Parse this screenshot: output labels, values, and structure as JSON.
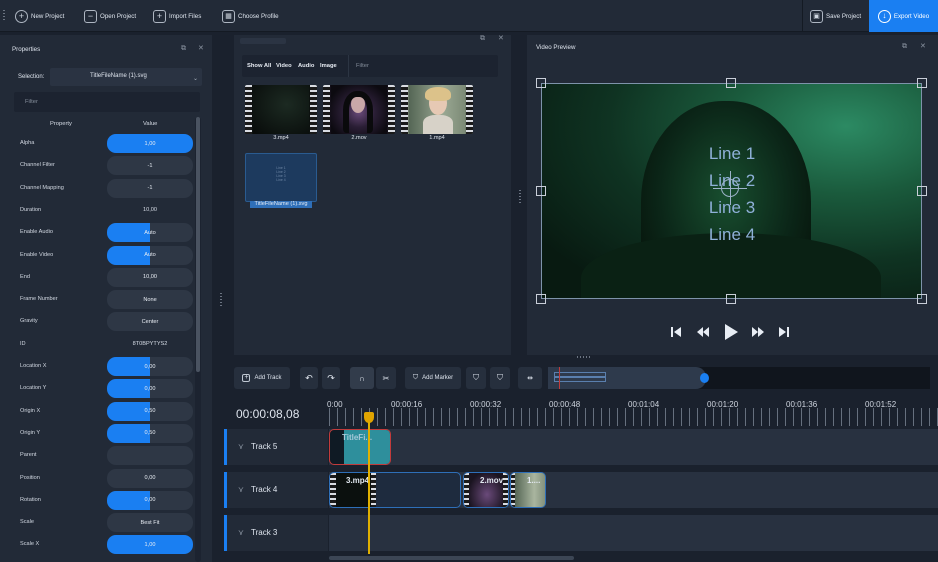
{
  "toolbar": {
    "new_project": "New Project",
    "open_project": "Open Project",
    "import_files": "Import Files",
    "choose_profile": "Choose Profile",
    "save_project": "Save Project",
    "export_video": "Export Video"
  },
  "properties": {
    "title": "Properties",
    "selection_label": "Selection:",
    "selection_value": "TitleFileName (1).svg",
    "filter_placeholder": "Filter",
    "col_property": "Property",
    "col_value": "Value",
    "rows": [
      {
        "name": "Alpha",
        "value": "1,00",
        "kind": "pill",
        "fill": 1.0
      },
      {
        "name": "Channel Filter",
        "value": "-1",
        "kind": "pill",
        "fill": 0
      },
      {
        "name": "Channel Mapping",
        "value": "-1",
        "kind": "pill",
        "fill": 0
      },
      {
        "name": "Duration",
        "value": "10,00",
        "kind": "plain"
      },
      {
        "name": "Enable Audio",
        "value": "Auto",
        "kind": "pill",
        "fill": 0.5
      },
      {
        "name": "Enable Video",
        "value": "Auto",
        "kind": "pill",
        "fill": 0.5
      },
      {
        "name": "End",
        "value": "10,00",
        "kind": "pill",
        "fill": 0
      },
      {
        "name": "Frame Number",
        "value": "None",
        "kind": "pill",
        "fill": 0
      },
      {
        "name": "Gravity",
        "value": "Center",
        "kind": "pill",
        "fill": 0
      },
      {
        "name": "ID",
        "value": "8T0BPYTYS2",
        "kind": "plain"
      },
      {
        "name": "Location X",
        "value": "0,00",
        "kind": "pill",
        "fill": 0.5
      },
      {
        "name": "Location Y",
        "value": "0,00",
        "kind": "pill",
        "fill": 0.5
      },
      {
        "name": "Origin X",
        "value": "0,50",
        "kind": "pill",
        "fill": 0.5
      },
      {
        "name": "Origin Y",
        "value": "0,50",
        "kind": "pill",
        "fill": 0.5
      },
      {
        "name": "Parent",
        "value": "",
        "kind": "pill",
        "fill": 0
      },
      {
        "name": "Position",
        "value": "0,00",
        "kind": "pill",
        "fill": 0
      },
      {
        "name": "Rotation",
        "value": "0,00",
        "kind": "pill",
        "fill": 0.5
      },
      {
        "name": "Scale",
        "value": "Best Fit",
        "kind": "pill",
        "fill": 0
      },
      {
        "name": "Scale X",
        "value": "1,00",
        "kind": "pill",
        "fill": 1.0
      }
    ]
  },
  "files": {
    "tabs": [
      "Show All",
      "Video",
      "Audio",
      "Image"
    ],
    "filter_placeholder": "Filter",
    "items": [
      {
        "name": "3.mp4"
      },
      {
        "name": "2.mov"
      },
      {
        "name": "1.mp4"
      },
      {
        "name": "TitleFileName (1).svg",
        "preview_lines": [
          "Line 1",
          "Line 2",
          "Line 3",
          "Line 4"
        ]
      }
    ]
  },
  "preview": {
    "title": "Video Preview",
    "lines": [
      "Line 1",
      "Line 2",
      "Line 3",
      "Line 4"
    ]
  },
  "timeline": {
    "add_track": "Add Track",
    "add_marker": "Add Marker",
    "timecode": "00:00:08,08",
    "ticks": [
      "0:00",
      "00:00:16",
      "00:00:32",
      "00:00:48",
      "00:01:04",
      "00:01:20",
      "00:01:36",
      "00:01:52"
    ],
    "tracks": [
      {
        "name": "Track 5",
        "clips": [
          "TitleFi..."
        ]
      },
      {
        "name": "Track 4",
        "clips": [
          "3.mp4",
          "2.mov",
          "1...."
        ]
      },
      {
        "name": "Track 3",
        "clips": []
      }
    ]
  },
  "colors": {
    "accent": "#1a7ff2",
    "panel": "#222a37",
    "background": "#1a212d"
  }
}
